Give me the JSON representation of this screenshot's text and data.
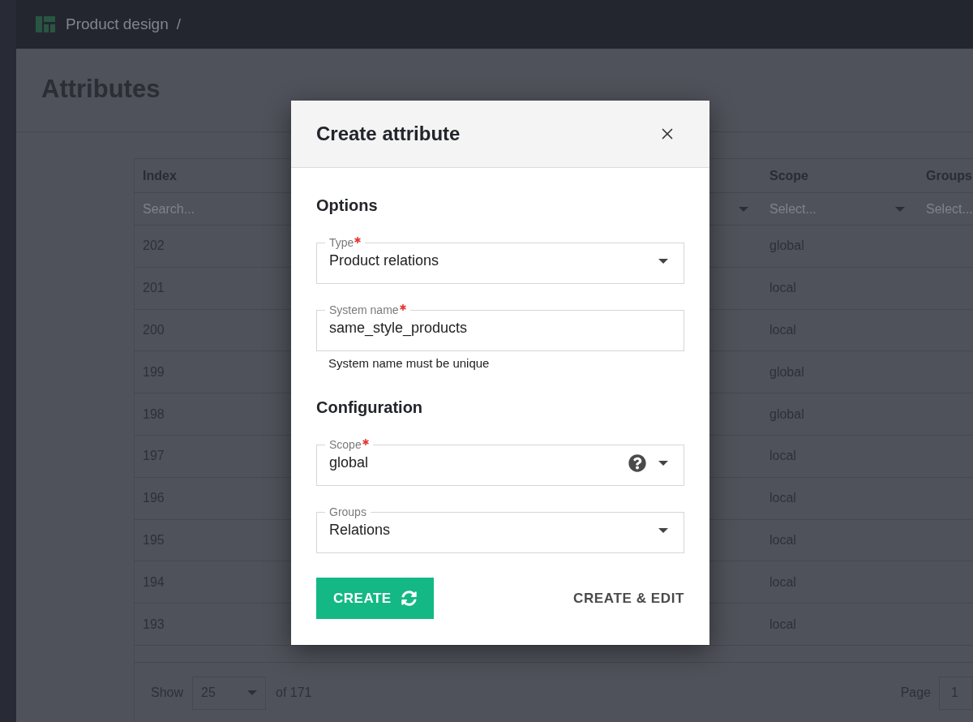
{
  "header": {
    "breadcrumbs": [
      {
        "label": "Product design"
      }
    ],
    "separator": "/"
  },
  "page": {
    "title": "Attributes"
  },
  "table": {
    "columns": [
      {
        "label": "Index",
        "filter": {
          "kind": "search",
          "placeholder": "Search..."
        }
      },
      {
        "filter": {
          "kind": "select"
        }
      },
      {
        "label": "Scope",
        "filter": {
          "kind": "select",
          "placeholder": "Select..."
        }
      },
      {
        "label": "Groups",
        "filter": {
          "placeholder": "Select..."
        }
      }
    ],
    "rows": [
      {
        "index": "202",
        "scope": "global"
      },
      {
        "index": "201",
        "scope": "local"
      },
      {
        "index": "200",
        "scope": "local"
      },
      {
        "index": "199",
        "scope": "global"
      },
      {
        "index": "198",
        "scope": "global"
      },
      {
        "index": "197",
        "scope": "local"
      },
      {
        "index": "196",
        "scope": "local"
      },
      {
        "index": "195",
        "scope": "local"
      },
      {
        "index": "194",
        "scope": "local"
      },
      {
        "index": "193",
        "scope": "local"
      }
    ]
  },
  "pagination": {
    "show_label": "Show",
    "page_size": "25",
    "total": "of 171",
    "page_label": "Page",
    "page": "1"
  },
  "dialog": {
    "title": "Create attribute",
    "sections": [
      {
        "heading": "Options",
        "fields": [
          {
            "kind": "select",
            "label": "Type",
            "required": true,
            "value": "Product relations"
          },
          {
            "kind": "text",
            "label": "System name",
            "required": true,
            "value": "same_style_products",
            "helper": "System name must be unique"
          }
        ]
      },
      {
        "heading": "Configuration",
        "fields": [
          {
            "kind": "select",
            "label": "Scope",
            "required": true,
            "value": "global",
            "help": true
          },
          {
            "kind": "select",
            "label": "Groups",
            "required": false,
            "value": "Relations"
          }
        ]
      }
    ],
    "buttons": [
      {
        "kind": "primary",
        "label": "CREATE"
      },
      {
        "kind": "text",
        "label": "CREATE & EDIT"
      }
    ]
  }
}
